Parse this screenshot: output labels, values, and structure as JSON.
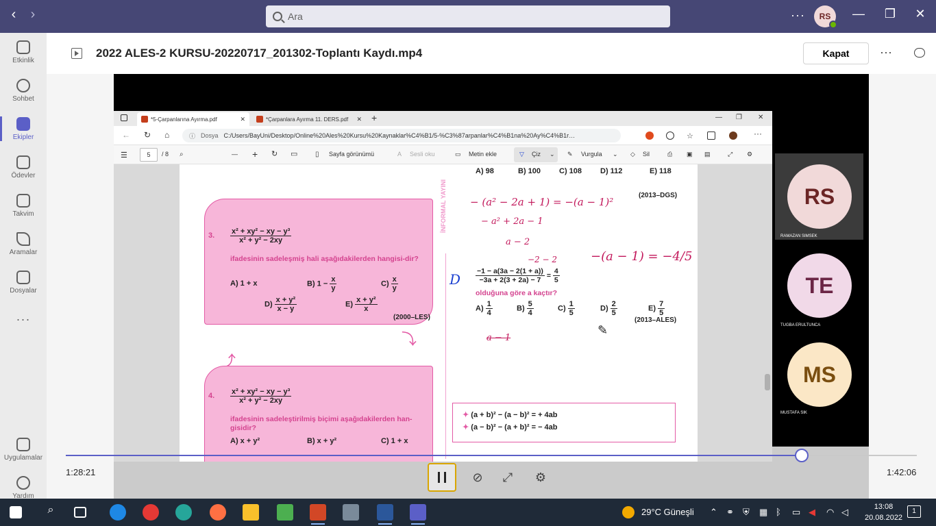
{
  "topbar": {
    "back": "‹",
    "forward": "›",
    "search_placeholder": "Ara",
    "more": "···",
    "avatar_initials": "RS",
    "min": "—",
    "max": "❐",
    "close": "✕"
  },
  "rail": {
    "items": [
      {
        "label": "Etkinlik"
      },
      {
        "label": "Sohbet"
      },
      {
        "label": "Ekipler"
      },
      {
        "label": "Ödevler"
      },
      {
        "label": "Takvim"
      },
      {
        "label": "Aramalar"
      },
      {
        "label": "Dosyalar"
      }
    ],
    "more": "···",
    "apps": "Uygulamalar",
    "help": "Yardım"
  },
  "header": {
    "title": "2022 ALES-2 KURSU-20220717_201302-Toplantı Kaydı.mp4",
    "close_label": "Kapat",
    "more": "···"
  },
  "edge": {
    "tabs": [
      {
        "title": "*5-Çarpanlarına Ayırma.pdf"
      },
      {
        "title": "*Çarpanlara Ayırma 11. DERS.pdf"
      }
    ],
    "plus": "+",
    "address_label": "Dosya",
    "address": "C:/Users/BayUni/Desktop/Online%20Ales%20Kursu%20Kaynaklar%C4%B1/5-%C3%87arpanlar%C4%B1na%20Ay%C4%B1rma.pdf",
    "page_current": "5",
    "page_total": "/ 8",
    "toolbar": {
      "minus": "—",
      "plus": "+",
      "page_view": "Sayfa görünümü",
      "read_aloud": "Sesli oku",
      "add_text": "Metin ekle",
      "draw": "Çiz",
      "highlight": "Vurgula",
      "erase": "Sil"
    }
  },
  "pdf": {
    "vertical_text": "İNFORMAL YAYINI",
    "q3": {
      "num": "3.",
      "num_expr": "x² + xy² − xy − y³",
      "den_expr": "x² + y² − 2xy",
      "question": "ifadesinin sadeleşmiş hali aşağıdakilerden hangisi-dir?",
      "a": "A) 1 + x",
      "b": "B) 1 −",
      "b_n": "x",
      "b_d": "y",
      "c": "C)",
      "c_n": "x",
      "c_d": "y",
      "d": "D)",
      "d_n": "x + y²",
      "d_d": "x − y",
      "e": "E)",
      "e_n": "x + y²",
      "e_d": "x",
      "source": "(2000–LES)"
    },
    "q4": {
      "num": "4.",
      "num_expr": "x² + xy² − xy − y³",
      "den_expr": "x² + y² − 2xy",
      "question": "ifadesinin sadeleştirilmiş biçimi aşağıdakilerden han-gisidir?",
      "a": "A)",
      "a_n": "x + y²",
      "b": "B)",
      "b_n": "x + y²",
      "c": "C) 1 +",
      "c_n": "x"
    },
    "right": {
      "answers_top": [
        "A) 98",
        "B) 100",
        "C) 108",
        "D) 112",
        "E) 118"
      ],
      "source_top": "(2013–DGS)",
      "expr_num": "−1 − a(3a − 2(1 + a))",
      "expr_den": "−3a + 2(3 + 2a) − 7",
      "eq": "=",
      "rhs_n": "4",
      "rhs_d": "5",
      "question": "olduğuna göre a kaçtır?",
      "a": "A)",
      "a_n": "1",
      "a_d": "4",
      "b": "B)",
      "b_n": "5",
      "b_d": "4",
      "c": "C)",
      "c_n": "1",
      "c_d": "5",
      "d": "D)",
      "d_n": "2",
      "d_d": "5",
      "e": "E)",
      "e_n": "7",
      "e_d": "5",
      "source": "(2013–ALES)",
      "formula1": "(a + b)² − (a − b)² = + 4ab",
      "formula2": "(a − b)² − (a + b)² = − 4ab",
      "bullet": "✦"
    },
    "ink": {
      "line1": "− (a² − 2a + 1) = −(a − 1)²",
      "line2": "− a² + 2a − 1",
      "line3": "a − 2",
      "line4": "−2 − 2",
      "line5": "−(a − 1) = −4/5",
      "line6": "a − 1",
      "circle": "D"
    }
  },
  "participants": [
    {
      "initials": "RS",
      "name": "RAMAZAN SIMSEK",
      "bg": "#f1d9d9",
      "fg": "#6b2525"
    },
    {
      "initials": "TE",
      "name": "TUGBA ERULTUNCA",
      "bg": "#f1d9e8",
      "fg": "#6b2545"
    },
    {
      "initials": "MS",
      "name": "MUSTAFA SIK",
      "bg": "#fbe7c6",
      "fg": "#7a4e10"
    }
  ],
  "playback": {
    "current": "1:28:21",
    "total": "1:42:06",
    "progress": 0.865
  },
  "taskbar": {
    "weather": "29°C  Güneşli",
    "time": "13:08",
    "date": "20.08.2022",
    "notif_count": "1",
    "accent": "#5b5fc7"
  }
}
